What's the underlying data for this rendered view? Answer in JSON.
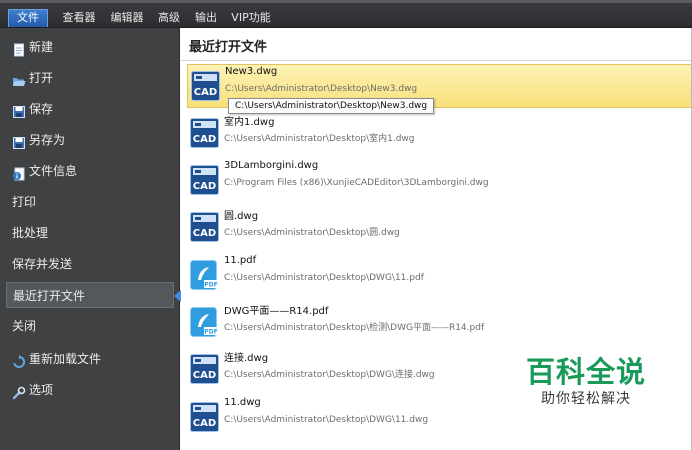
{
  "menubar": {
    "tabs": [
      {
        "label": "文件",
        "active": true
      },
      {
        "label": "查看器",
        "active": false
      },
      {
        "label": "编辑器",
        "active": false
      },
      {
        "label": "高级",
        "active": false
      },
      {
        "label": "输出",
        "active": false
      },
      {
        "label": "VIP功能",
        "active": false
      }
    ]
  },
  "sidebar": {
    "items": [
      {
        "label": "新建",
        "icon": "new-doc-icon"
      },
      {
        "label": "打开",
        "icon": "folder-open-icon"
      },
      {
        "label": "保存",
        "icon": "save-icon"
      },
      {
        "label": "另存为",
        "icon": "save-as-icon"
      },
      {
        "label": "文件信息",
        "icon": "file-info-icon"
      },
      {
        "label": "打印",
        "icon": ""
      },
      {
        "label": "批处理",
        "icon": ""
      },
      {
        "label": "保存并发送",
        "icon": ""
      },
      {
        "label": "最近打开文件",
        "icon": "",
        "active": true
      },
      {
        "label": "关闭",
        "icon": ""
      },
      {
        "label": "重新加载文件",
        "icon": "reload-icon"
      },
      {
        "label": "选项",
        "icon": "options-wrench-icon"
      }
    ]
  },
  "main": {
    "title": "最近打开文件",
    "files": [
      {
        "name": "New3.dwg",
        "path": "C:\\Users\\Administrator\\Desktop\\New3.dwg",
        "type": "cad",
        "highlight": true
      },
      {
        "name": "室内1.dwg",
        "path": "C:\\Users\\Administrator\\Desktop\\室内1.dwg",
        "type": "cad"
      },
      {
        "name": "3DLamborgini.dwg",
        "path": "C:\\Program Files (x86)\\XunjieCADEditor\\3DLamborgini.dwg",
        "type": "cad"
      },
      {
        "name": "圆.dwg",
        "path": "C:\\Users\\Administrator\\Desktop\\圆.dwg",
        "type": "cad"
      },
      {
        "name": "11.pdf",
        "path": "C:\\Users\\Administrator\\Desktop\\DWG\\11.pdf",
        "type": "pdf"
      },
      {
        "name": "DWG平面——R14.pdf",
        "path": "C:\\Users\\Administrator\\Desktop\\检测\\DWG平面——R14.pdf",
        "type": "pdf"
      },
      {
        "name": "连接.dwg",
        "path": "C:\\Users\\Administrator\\Desktop\\DWG\\连接.dwg",
        "type": "cad"
      },
      {
        "name": "11.dwg",
        "path": "C:\\Users\\Administrator\\Desktop\\DWG\\11.dwg",
        "type": "cad"
      }
    ]
  },
  "tooltip": {
    "text": "C:\\Users\\Administrator\\Desktop\\New3.dwg"
  },
  "watermark": {
    "main": "百科全说",
    "sub": "助你轻松解决"
  },
  "colors": {
    "accent": "#2c6cc4",
    "highlight": "#f8e07a",
    "sidebar_bg": "#3f4143",
    "watermark": "#1a9a5a"
  }
}
